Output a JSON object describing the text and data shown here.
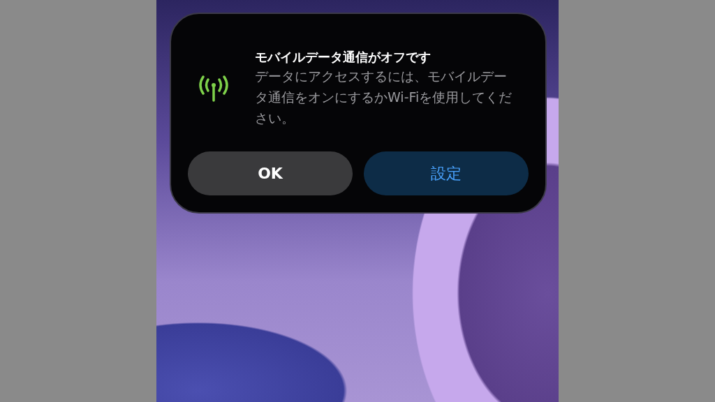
{
  "alert": {
    "title": "モバイルデータ通信がオフです",
    "message": "データにアクセスするには、モバイルデータ通信をオンにするかWi-Fiを使用してください。",
    "buttons": [
      {
        "label": "OK",
        "kind": "default"
      },
      {
        "label": "設定",
        "kind": "primary"
      }
    ]
  }
}
